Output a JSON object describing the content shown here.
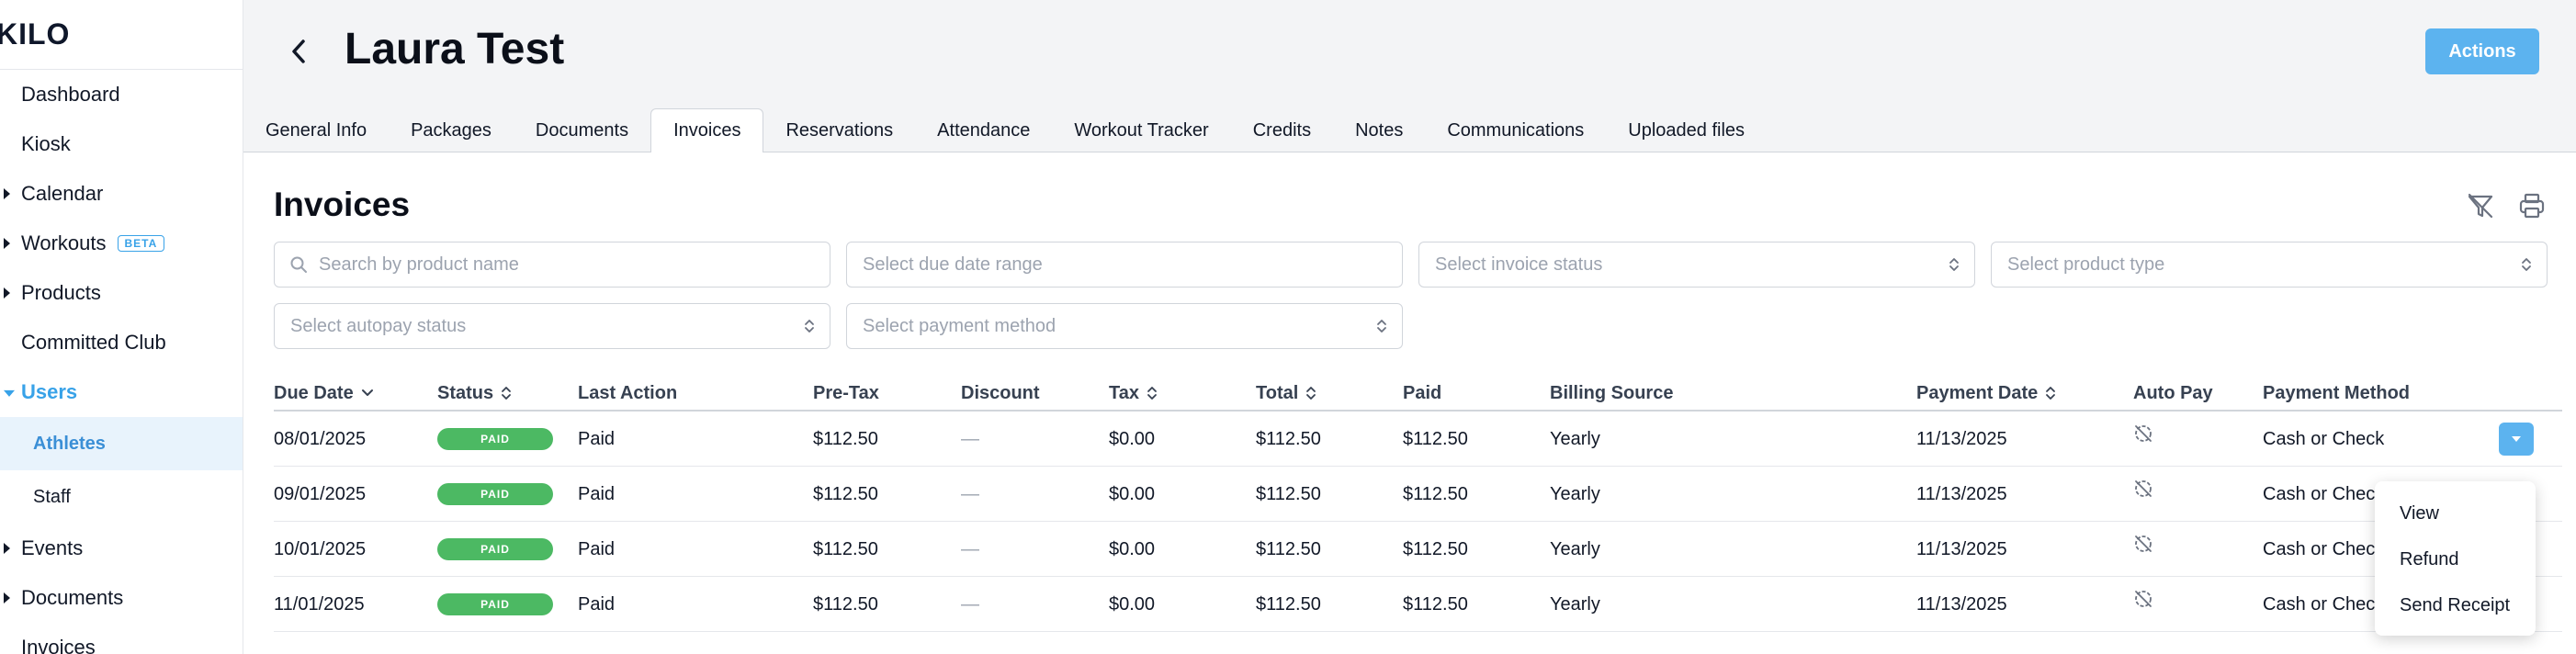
{
  "sidebar": {
    "logo": "KILO",
    "items": [
      {
        "label": "Dashboard"
      },
      {
        "label": "Kiosk"
      },
      {
        "label": "Calendar"
      },
      {
        "label": "Workouts",
        "badge": "BETA"
      },
      {
        "label": "Products"
      },
      {
        "label": "Committed Club"
      },
      {
        "label": "Users"
      },
      {
        "label": "Athletes"
      },
      {
        "label": "Staff"
      },
      {
        "label": "Events"
      },
      {
        "label": "Documents"
      },
      {
        "label": "Invoices"
      }
    ]
  },
  "header": {
    "title": "Laura Test",
    "actions_label": "Actions",
    "tabs": [
      "General Info",
      "Packages",
      "Documents",
      "Invoices",
      "Reservations",
      "Attendance",
      "Workout Tracker",
      "Credits",
      "Notes",
      "Communications",
      "Uploaded files"
    ]
  },
  "invoices": {
    "title": "Invoices",
    "filters": {
      "search_placeholder": "Search by product name",
      "due_date_placeholder": "Select due date range",
      "invoice_status_placeholder": "Select invoice status",
      "product_type_placeholder": "Select product type",
      "autopay_placeholder": "Select autopay status",
      "payment_method_placeholder": "Select payment method"
    },
    "columns": [
      "Due Date",
      "Status",
      "Last Action",
      "Pre-Tax",
      "Discount",
      "Tax",
      "Total",
      "Paid",
      "Billing Source",
      "Payment Date",
      "Auto Pay",
      "Payment Method"
    ],
    "rows": [
      {
        "due_date": "08/01/2025",
        "status": "PAID",
        "last_action": "Paid",
        "pre_tax": "$112.50",
        "discount": "—",
        "tax": "$0.00",
        "total": "$112.50",
        "paid": "$112.50",
        "billing_source": "Yearly",
        "payment_date": "11/13/2025",
        "payment_method": "Cash or Check"
      },
      {
        "due_date": "09/01/2025",
        "status": "PAID",
        "last_action": "Paid",
        "pre_tax": "$112.50",
        "discount": "—",
        "tax": "$0.00",
        "total": "$112.50",
        "paid": "$112.50",
        "billing_source": "Yearly",
        "payment_date": "11/13/2025",
        "payment_method": "Cash or Chec"
      },
      {
        "due_date": "10/01/2025",
        "status": "PAID",
        "last_action": "Paid",
        "pre_tax": "$112.50",
        "discount": "—",
        "tax": "$0.00",
        "total": "$112.50",
        "paid": "$112.50",
        "billing_source": "Yearly",
        "payment_date": "11/13/2025",
        "payment_method": "Cash or Chec"
      },
      {
        "due_date": "11/01/2025",
        "status": "PAID",
        "last_action": "Paid",
        "pre_tax": "$112.50",
        "discount": "—",
        "tax": "$0.00",
        "total": "$112.50",
        "paid": "$112.50",
        "billing_source": "Yearly",
        "payment_date": "11/13/2025",
        "payment_method": "Cash or Chec"
      }
    ],
    "row_menu": [
      "View",
      "Refund",
      "Send Receipt"
    ]
  },
  "colors": {
    "accent": "#38a2e8",
    "button": "#5cb3ef",
    "paid_badge": "#4cb963"
  },
  "icons": [
    "back-arrow-icon",
    "filter-off-icon",
    "printer-icon",
    "search-icon",
    "sort-icon",
    "autopay-off-icon",
    "chevron-down-icon"
  ]
}
